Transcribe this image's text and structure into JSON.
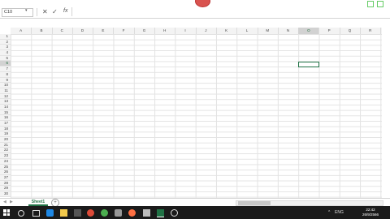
{
  "formula_bar": {
    "name_box": "C10",
    "fx_label": "fx",
    "cancel_label": "✕",
    "enter_label": "✓"
  },
  "columns": [
    "A",
    "B",
    "C",
    "D",
    "E",
    "F",
    "G",
    "H",
    "I",
    "J",
    "K",
    "L",
    "M",
    "N",
    "O",
    "P",
    "Q",
    "R"
  ],
  "rows": [
    "1",
    "2",
    "3",
    "4",
    "5",
    "6",
    "7",
    "8",
    "9",
    "10",
    "11",
    "12",
    "13",
    "14",
    "15",
    "16",
    "17",
    "18",
    "19",
    "20",
    "21",
    "22",
    "23",
    "24",
    "25",
    "26",
    "27",
    "28",
    "29",
    "30"
  ],
  "selection": {
    "column": "O",
    "row": "6"
  },
  "sheets": [
    {
      "label": "Sheet1",
      "active": true
    }
  ],
  "add_sheet_label": "+",
  "taskbar": {
    "clock_time": "22:42",
    "clock_date": "26/9/2566",
    "language": "ENG",
    "apps": [
      "search-icon",
      "task-view-icon",
      "edge-icon",
      "folder-icon",
      "store-icon",
      "chrome-icon",
      "opera-icon",
      "firefox-icon",
      "app-icon",
      "photos-icon",
      "excel-icon",
      "word-icon",
      "clock-app-icon"
    ]
  },
  "colors": {
    "accent": "#217346",
    "taskbar": "#1b1b1b"
  }
}
